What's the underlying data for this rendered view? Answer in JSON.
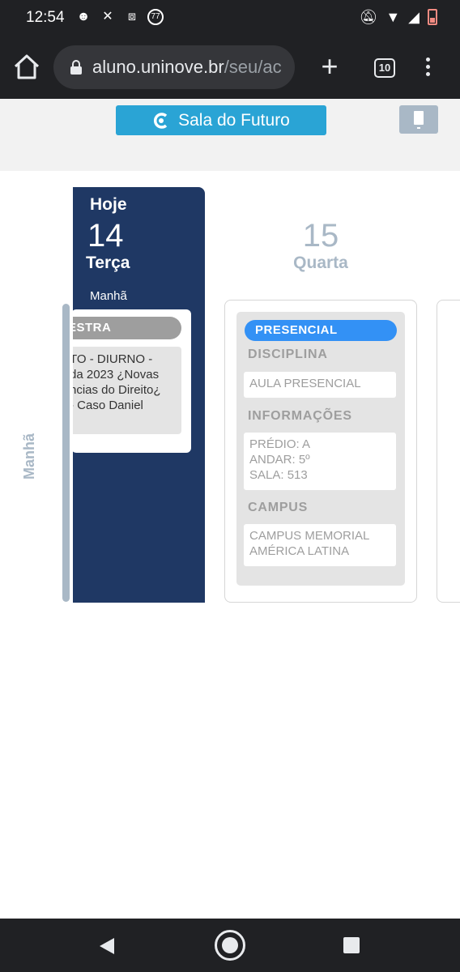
{
  "status_bar": {
    "time": "12:54",
    "left_icons": [
      "android-debug-icon",
      "x-icon",
      "capcut-icon",
      "notification-77-icon"
    ],
    "notification_badge": "77",
    "right_icons": [
      "notifications-off-icon",
      "wifi-icon",
      "signal-icon",
      "battery-low-icon"
    ]
  },
  "browser": {
    "url_host": "aluno.uninove.br",
    "url_path": "/seu/ac",
    "tab_count": "10"
  },
  "header": {
    "sala_button_label": "Sala do Futuro"
  },
  "schedule": {
    "side_label": "Manhã",
    "today": {
      "label": "Hoje",
      "day_number": "14",
      "weekday": "Terça",
      "period": "Manhã",
      "event_tag": "ESTRA",
      "event_text_lines": [
        "TO - DIURNO -",
        "da 2023 ¿Novas",
        "ncias do Direito¿",
        "- Caso Daniel"
      ]
    },
    "next_day": {
      "day_number": "15",
      "weekday": "Quarta",
      "event": {
        "tag": "PRESENCIAL",
        "disciplina_label": "DISCIPLINA",
        "disciplina_value": "AULA PRESENCIAL",
        "informacoes_label": "INFORMAÇÕES",
        "informacoes_lines": [
          "PRÉDIO: A",
          "ANDAR: 5º",
          "SALA: 513"
        ],
        "campus_label": "CAMPUS",
        "campus_lines": [
          "CAMPUS MEMORIAL",
          "AMÉRICA LATINA"
        ]
      }
    }
  },
  "colors": {
    "today_bg": "#1f3864",
    "sala_button": "#2aa4d5",
    "presencial_pill": "#3391f5",
    "muted_label": "#a9b8c6"
  }
}
